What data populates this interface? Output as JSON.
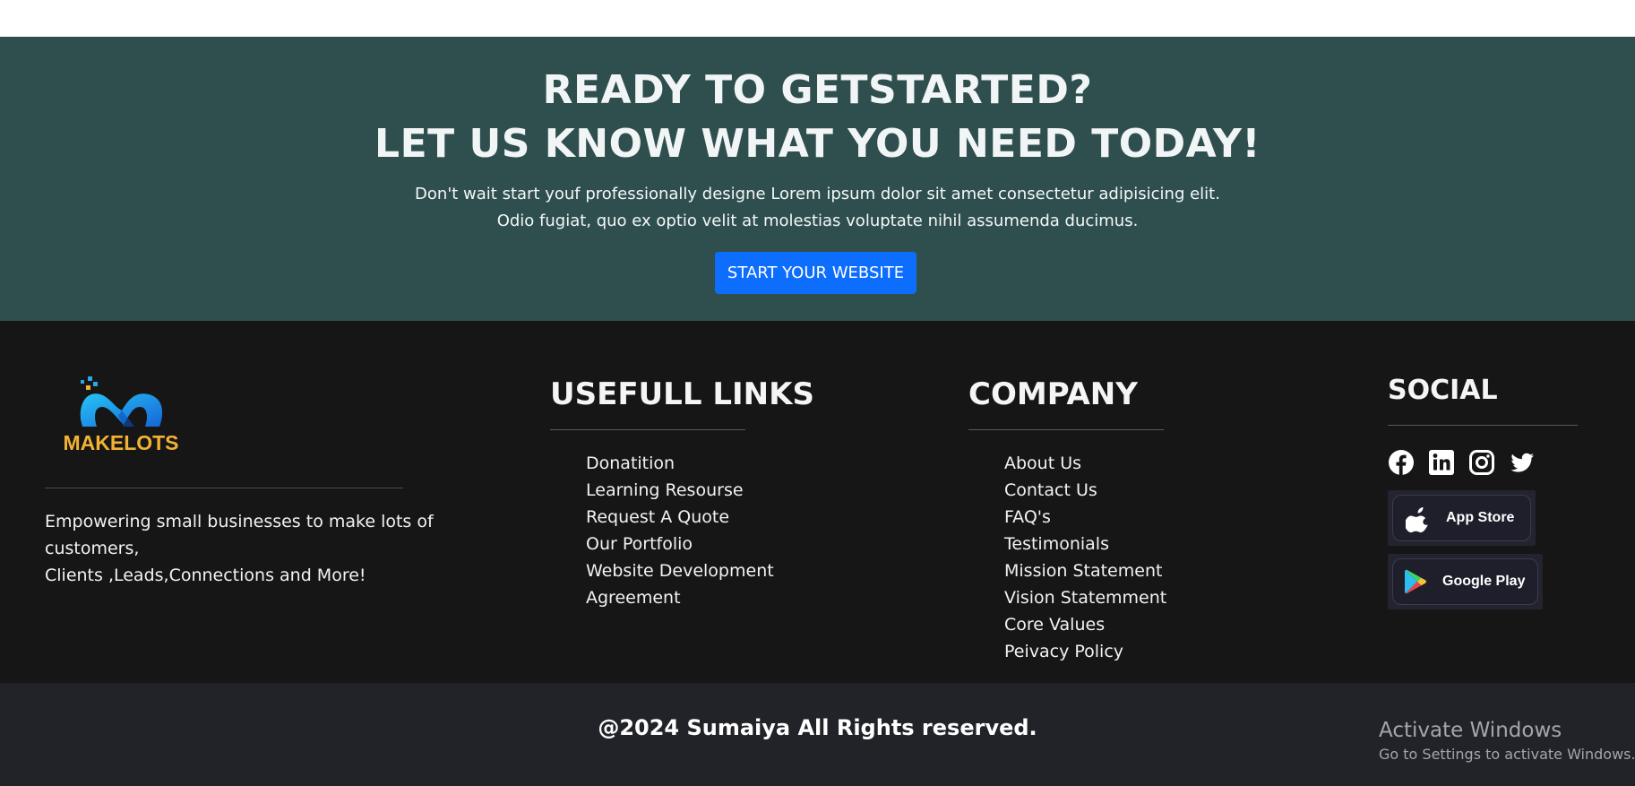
{
  "cta": {
    "heading_line1": "READY TO GETSTARTED?",
    "heading_line2": "LET US KNOW WHAT YOU NEED TODAY!",
    "subtext_line1": "Don't wait start youf professionally designe Lorem ipsum dolor sit amet consectetur adipisicing elit.",
    "subtext_line2": "Odio fugiat, quo ex optio velit at molestias voluptate nihil assumenda ducimus.",
    "button_label": "START YOUR WEBSITE"
  },
  "footer": {
    "logo_text": "MAKELOTS",
    "tagline_line1": "Empowering small businesses to make lots of customers,",
    "tagline_line2": "Clients ,Leads,Connections and More!",
    "useful_links": {
      "title": "USEFULL LINKS",
      "items": [
        "Donatition",
        "Learning Resourse",
        "Request A Quote",
        "Our Portfolio",
        "Website Development",
        "Agreement"
      ]
    },
    "company": {
      "title": "COMPANY",
      "items": [
        "About Us",
        "Contact Us",
        "FAQ's",
        "Testimonials",
        "Mission Statement",
        "Vision Statemment",
        "Core Values",
        "Peivacy Policy"
      ]
    },
    "social": {
      "title": "SOCIAL",
      "icons": [
        "facebook-icon",
        "linkedin-icon",
        "instagram-icon",
        "twitter-icon"
      ],
      "app_store_label": "App Store",
      "google_play_label": "Google Play"
    }
  },
  "bottom": {
    "copyright": "@2024 Sumaiya All Rights reserved.",
    "watermark_title": "Activate Windows",
    "watermark_sub": "Go to Settings to activate Windows."
  },
  "colors": {
    "cta_bg": "#2f4f4f",
    "button_bg": "#0d6efd",
    "footer_bg": "#161616",
    "bottom_bg": "#212329",
    "logo_blue": "#1aa3e8",
    "logo_gold": "#f2b233"
  }
}
